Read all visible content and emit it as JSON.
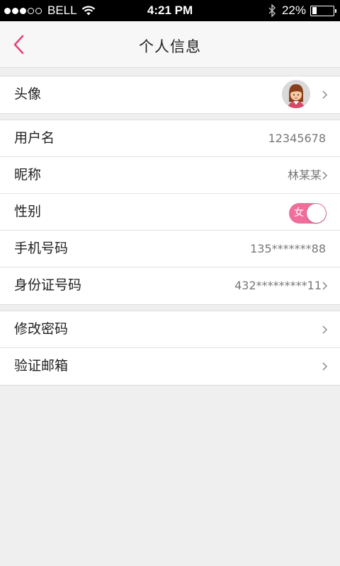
{
  "status_bar": {
    "carrier": "BELL",
    "time": "4:21 PM",
    "battery": "22%",
    "battery_level": 0.22,
    "signal_bars_filled": 3,
    "signal_bars_total": 5
  },
  "nav": {
    "title": "个人信息",
    "back_icon": "chevron-left-icon"
  },
  "colors": {
    "accent": "#e9417e",
    "toggle_on": "#f06e9c"
  },
  "groups": {
    "avatar_row": {
      "label": "头像"
    },
    "username": {
      "label": "用户名",
      "value": "12345678"
    },
    "nickname": {
      "label": "昵称",
      "value": "林某某"
    },
    "gender": {
      "label": "性别",
      "toggle_label": "女"
    },
    "phone": {
      "label": "手机号码",
      "value": "135*******88"
    },
    "id_number": {
      "label": "身份证号码",
      "value": "432*********11"
    },
    "change_password": {
      "label": "修改密码"
    },
    "verify_email": {
      "label": "验证邮箱"
    }
  }
}
